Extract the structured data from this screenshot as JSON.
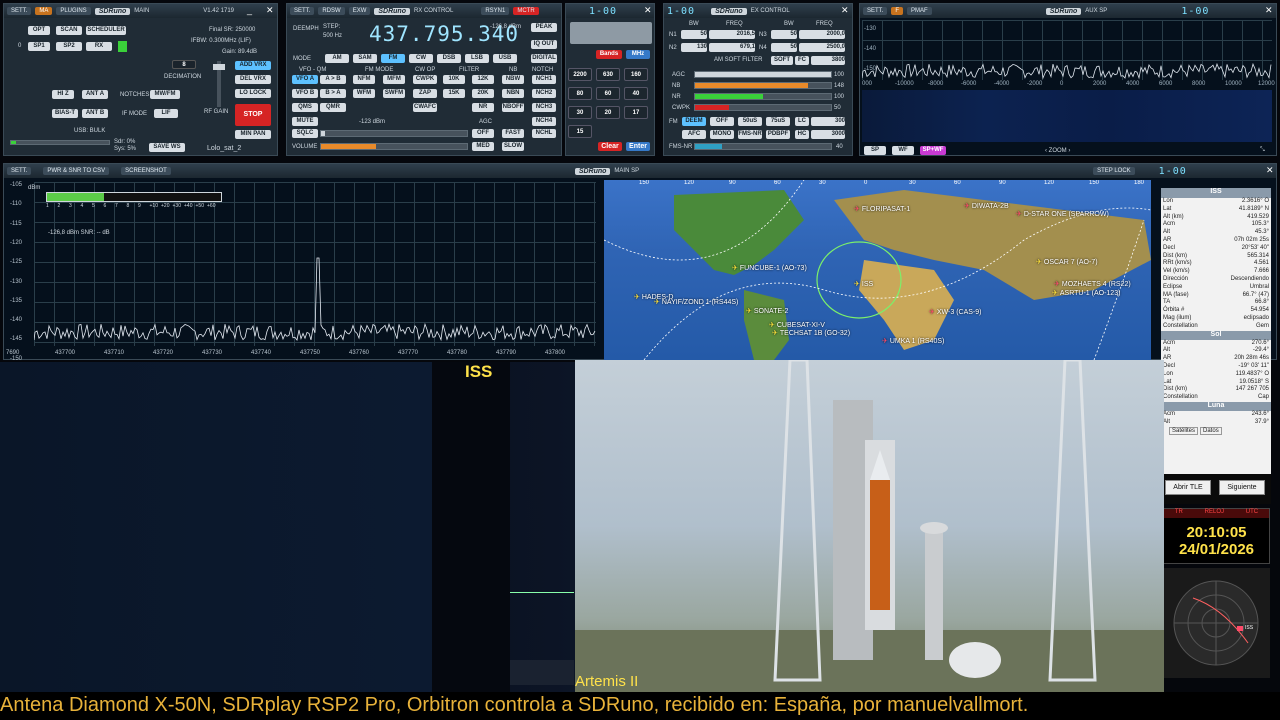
{
  "main": {
    "settings": "SETT.",
    "ma": "MA",
    "plugins": "PLUGINS",
    "title": "SDRuno",
    "subtitle": "MAIN",
    "version": "V1.42 1719",
    "final_sr": "Final SR: 250000",
    "ifbw": "IFBW: 0.300MHz (LIF)",
    "gain": "Gain: 89.4dB",
    "opt": "OPT",
    "scan": "SCAN",
    "scheduler": "SCHEDULER",
    "zero": "0",
    "sp1": "SP1",
    "sp2": "SP2",
    "rx": "RX",
    "decimation_val": "8",
    "decimation": "DECIMATION",
    "add_vrx": "ADD VRX",
    "del_vrx": "DEL VRX",
    "lo_lock": "LO LOCK",
    "hiz": "HI Z",
    "ant_a": "ANT A",
    "notches": "NOTCHES",
    "mwfm": "MW/FM",
    "bias_t": "BIAS-T",
    "ant_b": "ANT B",
    "if_mode": "IF MODE",
    "lif": "LIF",
    "rf_gain": "RF GAIN",
    "stop": "STOP",
    "min_pan": "MIN PAN",
    "usb_bulk": "USB: BULK",
    "sdr": "Sdr: 0%",
    "sys": "Sys: 5%",
    "save_ws": "SAVE WS",
    "workspace": "Lolo_sat_2"
  },
  "rx": {
    "settings": "SETT.",
    "rdsw": "RDSW",
    "exw": "EXW",
    "title": "SDRuno",
    "subtitle": "RX CONTROL",
    "rsyn": "RSYN1",
    "mctr": "MCTR",
    "deemph": "DEEMPH",
    "step": "STEP:",
    "step_val": "500 Hz",
    "freq": "437.795.340",
    "level": "-126,8 dBm",
    "peak": "PEAK",
    "iq_out": "IQ OUT",
    "digital": "DIGITAL",
    "mode": "MODE",
    "modes": [
      "AM",
      "SAM",
      "FM",
      "CW",
      "DSB",
      "LSB",
      "USB"
    ],
    "vfo_qm": "VFO - QM",
    "fm_mode": "FM MODE",
    "cw_op": "CW OP",
    "filter": "FILTER",
    "nb": "NB",
    "notch": "NOTCH",
    "vfo_a": "VFO A",
    "ab": "A > B",
    "nfm": "NFM",
    "mfm": "MFM",
    "cwpk": "CWPK",
    "f10k": "10K",
    "f12k": "12K",
    "nbw": "NBW",
    "nch1": "NCH1",
    "vfo_b": "VFO B",
    "ba": "B > A",
    "wfm": "WFM",
    "swfm": "SWFM",
    "zap": "ZAP",
    "f15k": "15K",
    "f20k": "20K",
    "nbn": "NBN",
    "nch2": "NCH2",
    "qms": "QMS",
    "qmr": "QMR",
    "cwafc": "CWAFC",
    "nr": "NR",
    "nboff": "NBOFF",
    "nch3": "NCH3",
    "mute": "MUTE",
    "sq_level": "-123 dBm",
    "agc": "AGC",
    "nch4": "NCH4",
    "sqlc": "SQLC",
    "off": "OFF",
    "fast": "FAST",
    "nchl": "NCHL",
    "volume": "VOLUME",
    "med": "MED",
    "slow": "SLOW"
  },
  "keypad": {
    "display": "1-00",
    "bands": "Bands",
    "mhz": "MHz",
    "keys": [
      "2200",
      "630",
      "160",
      "80",
      "60",
      "40",
      "30",
      "20",
      "17",
      "15"
    ],
    "clear": "Clear",
    "enter": "Enter"
  },
  "ex": {
    "title": "SDRuno",
    "subtitle": "EX CONTROL",
    "display": "1-00",
    "bw": "BW",
    "freq": "FREQ",
    "n1": "N1",
    "n1_bw": "50",
    "n1_f": "2016,5",
    "n2": "N2",
    "n2_bw": "130",
    "n2_f": "679,1",
    "n3": "N3",
    "n3_bw": "50",
    "n3_f": "2000,0",
    "n4": "N4",
    "n4_bw": "50",
    "n4_f": "2500,0",
    "am_soft": "AM SOFT FILTER",
    "soft": "SOFT",
    "fc": "FC",
    "fc_val": "3800",
    "agc": "AGC",
    "agc_v": "100",
    "nb": "NB",
    "nb_v": "148",
    "nr": "NR",
    "nr_v": "100",
    "cwpk": "CWPK",
    "cwpk_v": "50",
    "fm": "FM",
    "deem": "DEEM",
    "off": "OFF",
    "us50": "50uS",
    "us75": "75uS",
    "lc": "LC",
    "lc_v": "300",
    "afc": "AFC",
    "mono": "MONO",
    "fms_nr": "FMS-NR",
    "pdbpf": "PDBPF",
    "hc": "HC",
    "hc_v": "3000",
    "pms_nr": "FMS-NR",
    "pms_v": "40"
  },
  "aux": {
    "settings": "SETT.",
    "f": "F",
    "pmaf": "PMAF",
    "title": "SDRuno",
    "subtitle": "AUX SP",
    "display": "1-00",
    "db": [
      "-130",
      "-140",
      "-150"
    ],
    "freqs": [
      "000",
      "-10000",
      "-8000",
      "-6000",
      "-4000",
      "-2000",
      "0",
      "2000",
      "4000",
      "6000",
      "8000",
      "10000",
      "12000"
    ],
    "sp": "SP",
    "wf": "WF",
    "spwf": "SP+WF",
    "zoom": "ZOOM"
  },
  "mainsp": {
    "settings": "SETT.",
    "pwr": "PWR & SNR TO CSV",
    "screenshot": "SCREENSHOT",
    "title": "SDRuno",
    "subtitle": "MAIN SP",
    "step_lock": "STEP LOCK",
    "display": "1-00",
    "dbm": "dBm",
    "db": [
      "-105",
      "-110",
      "-115",
      "-120",
      "-125",
      "-130",
      "-135",
      "-140",
      "-145",
      "-150",
      "-155",
      "-160"
    ],
    "smeter": [
      "S",
      "1",
      "2",
      "3",
      "4",
      "5",
      "6",
      "7",
      "8",
      "9",
      "+10",
      "+20",
      "+30",
      "+40",
      "+50",
      "+60"
    ],
    "reading": "-126,8 dBm  SNR: -- dB",
    "freqs": [
      "7690",
      "437700",
      "437710",
      "437720",
      "437730",
      "437740",
      "437750",
      "437760",
      "437770",
      "437780",
      "437790",
      "437800"
    ]
  },
  "map": {
    "top": [
      "150",
      "120",
      "90",
      "60",
      "30",
      "0",
      "30",
      "60",
      "90",
      "120",
      "150",
      "180"
    ],
    "lat": [
      "60",
      "30",
      "0"
    ],
    "sats": [
      "FLORIPASAT-1",
      "DIWATA-2B",
      "D-STAR ONE (SPARROW)",
      "FUNCUBE-1 (AO-73)",
      "ISS",
      "OSCAR 7 (AO-7)",
      "HADES-D",
      "NAYIF/ZOND 1 (RS44S)",
      "MOZHAETS 4 (RS22)",
      "ASRTU-1 (AO-123)",
      "SONATE-2",
      "XW-3 (CAS-9)",
      "CUBESAT-XI-V",
      "TECHSAT 1B (GO-32)",
      "UMKA 1 (RS40S)"
    ]
  },
  "orbitron": {
    "header": "ISS",
    "rows": [
      [
        "Lon",
        "2.3616° O"
      ],
      [
        "Lat",
        "41.8189° N"
      ],
      [
        "Alt (km)",
        "419.529"
      ],
      [
        "Acm",
        "105.3°"
      ],
      [
        "Alt",
        "45.3°"
      ],
      [
        "AR",
        "07h 02m 25s"
      ],
      [
        "Decl",
        "20°53' 40\""
      ],
      [
        "Dist (km)",
        "565.314"
      ],
      [
        "RRt (km/s)",
        "4.561"
      ],
      [
        "Vel (km/s)",
        "7.666"
      ],
      [
        "Dirección",
        "Descendiendo"
      ],
      [
        "Eclipse",
        "Umbral"
      ],
      [
        "MA (fase)",
        "66.7° (47)"
      ],
      [
        "TA",
        "66.8°"
      ],
      [
        "Órbita #",
        "54.954"
      ],
      [
        "Mag (ilum)",
        "eclipsado"
      ],
      [
        "Constellation",
        "Gem"
      ]
    ],
    "sol_header": "Sol",
    "sol_rows": [
      [
        "Acm",
        "270.6°"
      ],
      [
        "Alt",
        "-29.4°"
      ],
      [
        "AR",
        "20h 28m 46s"
      ],
      [
        "Decl",
        "-19° 03' 11\""
      ],
      [
        "Lon",
        "119.4837° O"
      ],
      [
        "Lat",
        "19.0518° S"
      ],
      [
        "Dist (km)",
        "147 267 705"
      ],
      [
        "Constellation",
        "Cap"
      ]
    ],
    "luna_header": "Luna",
    "luna_rows": [
      [
        "Acm",
        "243.6°"
      ],
      [
        "Alt",
        "37.9°"
      ]
    ],
    "tab1": "Satélites",
    "tab2": "Datos",
    "abrir": "Abrir TLE",
    "siguiente": "Siguiente",
    "clock_labels": [
      "TR",
      "RELOJ",
      "UTC"
    ],
    "time": "20:10:05",
    "date": "24/01/2026",
    "radar_label": "ISS"
  },
  "video": {
    "iss_label": "ISS",
    "caption": "Artemis II"
  },
  "ticker": "Antena Diamond X-50N, SDRplay RSP2 Pro, Orbitron controla a SDRuno, recibido en: España, por manuelvallmort."
}
